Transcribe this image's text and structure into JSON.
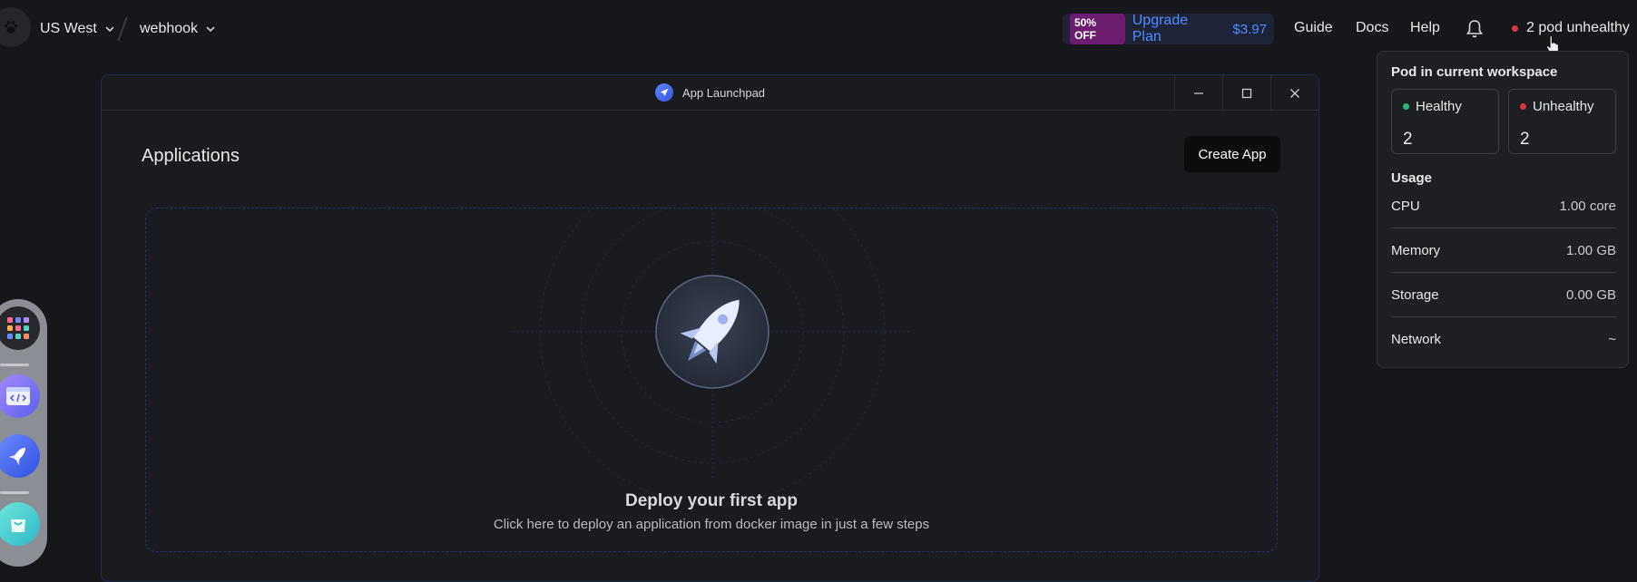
{
  "topbar": {
    "region": "US West",
    "workspace": "webhook",
    "promo": {
      "badge": "50% OFF",
      "upgrade": "Upgrade Plan",
      "price": "$3.97"
    },
    "links": {
      "guide": "Guide",
      "docs": "Docs",
      "help": "Help"
    },
    "pod_status": "2 pod unhealthy"
  },
  "window": {
    "title": "App Launchpad",
    "heading": "Applications",
    "create_button": "Create App",
    "empty_title": "Deploy your first app",
    "empty_subtitle": "Click here to deploy an application from docker image in just a few steps"
  },
  "pod_panel": {
    "title": "Pod in current workspace",
    "healthy_label": "Healthy",
    "healthy_count": "2",
    "unhealthy_label": "Unhealthy",
    "unhealthy_count": "2",
    "usage_title": "Usage",
    "rows": [
      {
        "label": "CPU",
        "value": "1.00 core"
      },
      {
        "label": "Memory",
        "value": "1.00 GB"
      },
      {
        "label": "Storage",
        "value": "0.00 GB"
      },
      {
        "label": "Network",
        "value": "~"
      }
    ]
  },
  "colors": {
    "accent": "#4f8dff",
    "healthy": "#2bb673",
    "unhealthy": "#d9363e",
    "background": "#16171b"
  }
}
